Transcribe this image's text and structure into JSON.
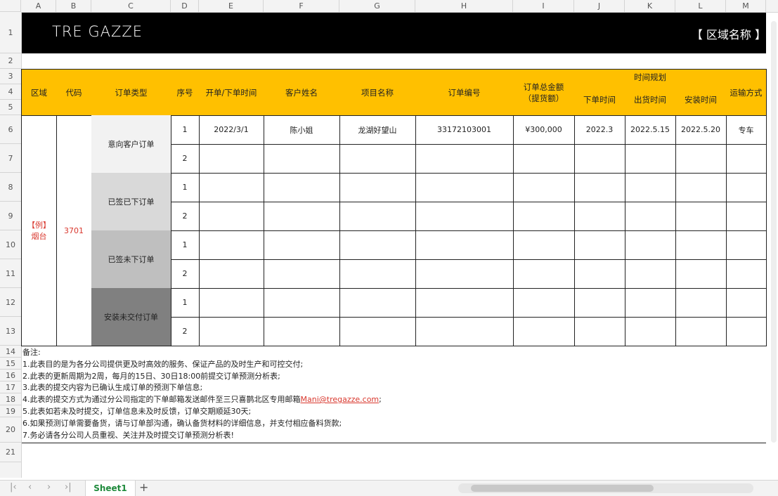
{
  "columns": [
    "A",
    "B",
    "C",
    "D",
    "E",
    "F",
    "G",
    "H",
    "I",
    "J",
    "K",
    "L",
    "M"
  ],
  "rows": [
    "1",
    "2",
    "3",
    "4",
    "5",
    "6",
    "7",
    "8",
    "9",
    "10",
    "11",
    "12",
    "13",
    "14",
    "15",
    "16",
    "17",
    "18",
    "19",
    "20",
    "21"
  ],
  "banner": {
    "logo": "TRE GAZZE",
    "region": "【 区域名称 】"
  },
  "headers": {
    "region": "区域",
    "code": "代码",
    "order_type": "订单类型",
    "seq": "序号",
    "open_time": "开单/下单时间",
    "customer": "客户姓名",
    "project": "项目名称",
    "order_no": "订单编号",
    "amount": "订单总金额\n（提货额）",
    "time_plan": "时间规划",
    "order_time": "下单时间",
    "ship_time": "出货时间",
    "install_time": "安装时间",
    "transport": "运输方式"
  },
  "example": {
    "region": "【例】\n烟台",
    "code": "3701"
  },
  "order_types": [
    "意向客户订单",
    "已签已下订单",
    "已签未下订单",
    "安装未交付订单"
  ],
  "first_row": {
    "seq": "1",
    "open_time": "2022/3/1",
    "customer": "陈小姐",
    "project": "龙湖好望山",
    "order_no": "33172103001",
    "amount": "¥300,000",
    "order_time": "2022.3",
    "ship_time": "2022.5.15",
    "install_time": "2022.5.20",
    "transport": "专车"
  },
  "notes": [
    "备注:",
    "1.此表目的是为各分公司提供更及时高效的服务、保证产品的及时生产和可控交付;",
    "2.此表的更新周期为2周，每月的15日、30日18:00前提交订单预测分析表;",
    "3.此表的提交内容为已确认生成订单的预测下单信息;",
    "4.此表的提交方式为通过分公司指定的下单邮箱发送邮件至三只喜鹊北区专用邮箱",
    "5.此表如若未及时提交，订单信息未及时反馈，订单交期顺延30天;",
    "6.如果预测订单需要备货，请与订单部沟通，确认备货材料的详细信息，并支付相应备料货款;",
    "7.务必请各分公司人员重视、关注并及时提交订单预测分析表!"
  ],
  "email": "Mani@tregazze.com",
  "sheet_tab": "Sheet1",
  "accent_color": "#ffc000",
  "red_color": "#d9382e"
}
